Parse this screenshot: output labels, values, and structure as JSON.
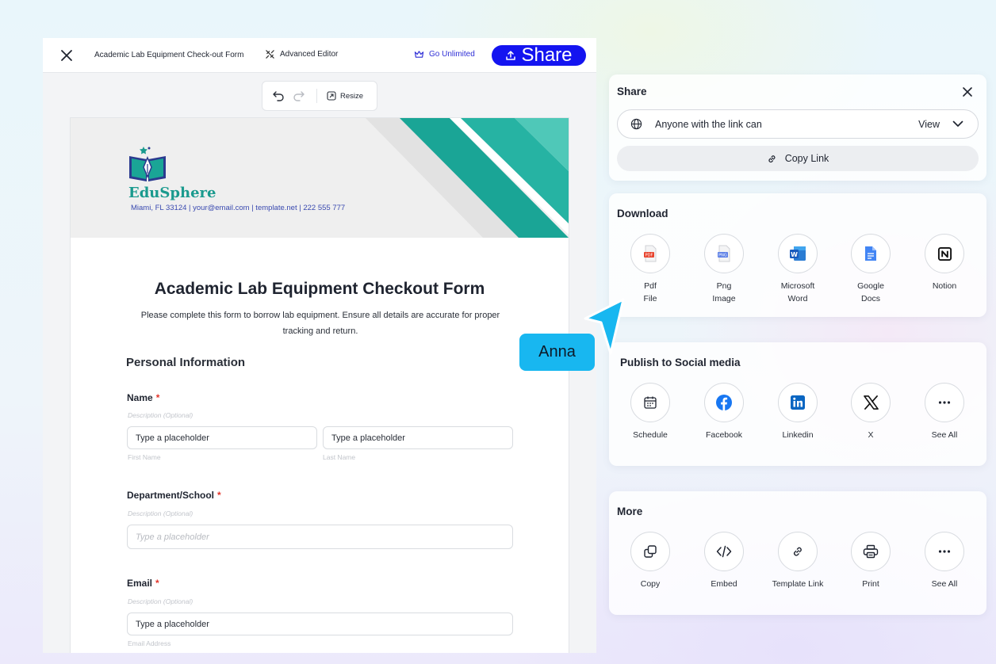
{
  "editor": {
    "doc_title": "Academic Lab Equipment Check-out Form",
    "advanced_editor": "Advanced Editor",
    "go_unlimited": "Go Unlimited",
    "share_button": "Share",
    "resize": "Resize"
  },
  "form": {
    "brand": "EduSphere",
    "contact": "Miami, FL 33124 | your@email.com | template.net | 222 555 777",
    "title": "Academic Lab Equipment Checkout Form",
    "description": "Please complete this form to borrow lab equipment. Ensure all details are accurate for proper tracking and return.",
    "section": "Personal Information",
    "name_label": "Name",
    "name_hint": "Description (Optional)",
    "first_name_value": "Type a placeholder",
    "first_name_sub": "First Name",
    "last_name_value": "Type a placeholder",
    "last_name_sub": "Last Name",
    "dept_label": "Department/School",
    "dept_hint": "Description (Optional)",
    "dept_placeholder": "Type a placeholder",
    "email_label": "Email",
    "email_hint": "Description (Optional)",
    "email_value": "Type a placeholder",
    "email_sub": "Email Address",
    "required_mark": "*"
  },
  "share_panel": {
    "title": "Share",
    "permission_text": "Anyone with the link can",
    "permission_value": "View",
    "copy_link": "Copy Link"
  },
  "download": {
    "title": "Download",
    "items": [
      {
        "label": "Pdf\nFile",
        "icon": "pdf-file-icon"
      },
      {
        "label": "Png\nImage",
        "icon": "png-image-icon"
      },
      {
        "label": "Microsoft\nWord",
        "icon": "microsoft-word-icon"
      },
      {
        "label": "Google\nDocs",
        "icon": "google-docs-icon"
      },
      {
        "label": "Notion",
        "icon": "notion-icon"
      }
    ]
  },
  "social": {
    "title": "Publish to Social media",
    "items": [
      {
        "label": "Schedule",
        "icon": "calendar-icon"
      },
      {
        "label": "Facebook",
        "icon": "facebook-icon"
      },
      {
        "label": "Linkedin",
        "icon": "linkedin-icon"
      },
      {
        "label": "X",
        "icon": "x-icon"
      },
      {
        "label": "See All",
        "icon": "more-icon"
      }
    ]
  },
  "more": {
    "title": "More",
    "items": [
      {
        "label": "Copy",
        "icon": "copy-icon"
      },
      {
        "label": "Embed",
        "icon": "embed-code-icon"
      },
      {
        "label": "Template Link",
        "icon": "link-icon"
      },
      {
        "label": "Print",
        "icon": "printer-icon"
      },
      {
        "label": "See All",
        "icon": "more-icon"
      }
    ]
  },
  "collaborator": {
    "name": "Anna"
  },
  "colors": {
    "accent_blue": "#1414f0",
    "teal": "#1a9a8e",
    "cursor_cyan": "#18b7f0",
    "required_red": "#e3352b"
  }
}
